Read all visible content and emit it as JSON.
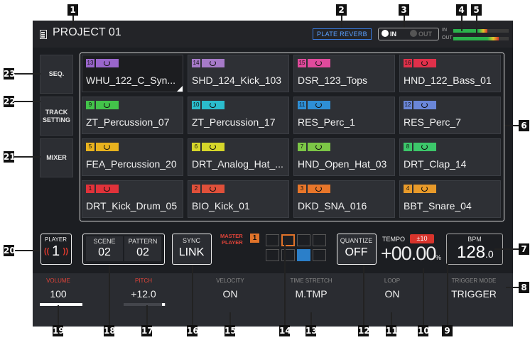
{
  "project": {
    "title": "PROJECT 01"
  },
  "fx": {
    "name": "PLATE REVERB"
  },
  "io": {
    "in_label": "IN",
    "out_label": "OUT",
    "in_meter_label": "IN",
    "out_meter_label": "OUT",
    "in_level": 0.62,
    "out_level": 0.82
  },
  "sidebar": [
    {
      "id": 23,
      "label": "SEQ."
    },
    {
      "id": 22,
      "label": "TRACK SETTING"
    },
    {
      "id": 21,
      "label": "MIXER"
    }
  ],
  "pads": [
    {
      "num": "13",
      "name": "WHU_122_C_Syn...",
      "color": "#9a66cc",
      "selected": true
    },
    {
      "num": "14",
      "name": "SHD_124_Kick_103",
      "color": "#a67ac8"
    },
    {
      "num": "15",
      "name": "DSR_123_Tops",
      "color": "#e04a9c"
    },
    {
      "num": "16",
      "name": "HND_122_Bass_01",
      "color": "#e0304a"
    },
    {
      "num": "9",
      "name": "ZT_Percussion_07",
      "color": "#43c34a"
    },
    {
      "num": "10",
      "name": "ZT_Percussion_17",
      "color": "#2bbccc"
    },
    {
      "num": "11",
      "name": "RES_Perc_1",
      "color": "#2e8fd6"
    },
    {
      "num": "12",
      "name": "RES_Perc_7",
      "color": "#6a86d8"
    },
    {
      "num": "5",
      "name": "FEA_Percussion_20",
      "color": "#e8b21e"
    },
    {
      "num": "6",
      "name": "DRT_Analog_Hat_...",
      "color": "#d6d62a"
    },
    {
      "num": "7",
      "name": "HND_Open_Hat_03",
      "color": "#7cc646"
    },
    {
      "num": "8",
      "name": "DRT_Clap_14",
      "color": "#3cc76a"
    },
    {
      "num": "1",
      "name": "DRT_Kick_Drum_05",
      "color": "#e0323a"
    },
    {
      "num": "2",
      "name": "BIO_Kick_01",
      "color": "#e0503a"
    },
    {
      "num": "3",
      "name": "DKD_SNA_016",
      "color": "#e8762a"
    },
    {
      "num": "4",
      "name": "BBT_Snare_04",
      "color": "#e89a2a"
    }
  ],
  "player": {
    "label": "PLAYER",
    "number": "1",
    "left_mark": "((",
    "right_mark": "))"
  },
  "scene": {
    "scene_label": "SCENE",
    "scene_value": "02",
    "pattern_label": "PATTERN",
    "pattern_value": "02"
  },
  "sync": {
    "label": "SYNC",
    "value": "LINK"
  },
  "master": {
    "label_line1": "MASTER",
    "label_line2": "PLAYER",
    "number": "1"
  },
  "quantize": {
    "label": "QUANTIZE",
    "value": "OFF"
  },
  "tempo": {
    "label": "TEMPO",
    "range": "±10",
    "value": "+00.00",
    "unit": "%"
  },
  "bpm": {
    "label": "BPM",
    "value": "128",
    "decimal": ".0"
  },
  "params": [
    {
      "label": "VOLUME",
      "value": "100"
    },
    {
      "label": "PITCH",
      "value": "+12.0"
    },
    {
      "label": "VELOCITY",
      "value": "ON"
    },
    {
      "label": "TIME STRETCH",
      "value": "M.TMP"
    },
    {
      "label": "LOOP",
      "value": "ON"
    },
    {
      "label": "TRIGGER MODE",
      "value": "TRIGGER"
    }
  ],
  "callouts": [
    "1",
    "2",
    "3",
    "4",
    "5",
    "6",
    "7",
    "8",
    "9",
    "10",
    "11",
    "12",
    "13",
    "14",
    "15",
    "16",
    "17",
    "18",
    "19",
    "20",
    "21",
    "22",
    "23"
  ]
}
